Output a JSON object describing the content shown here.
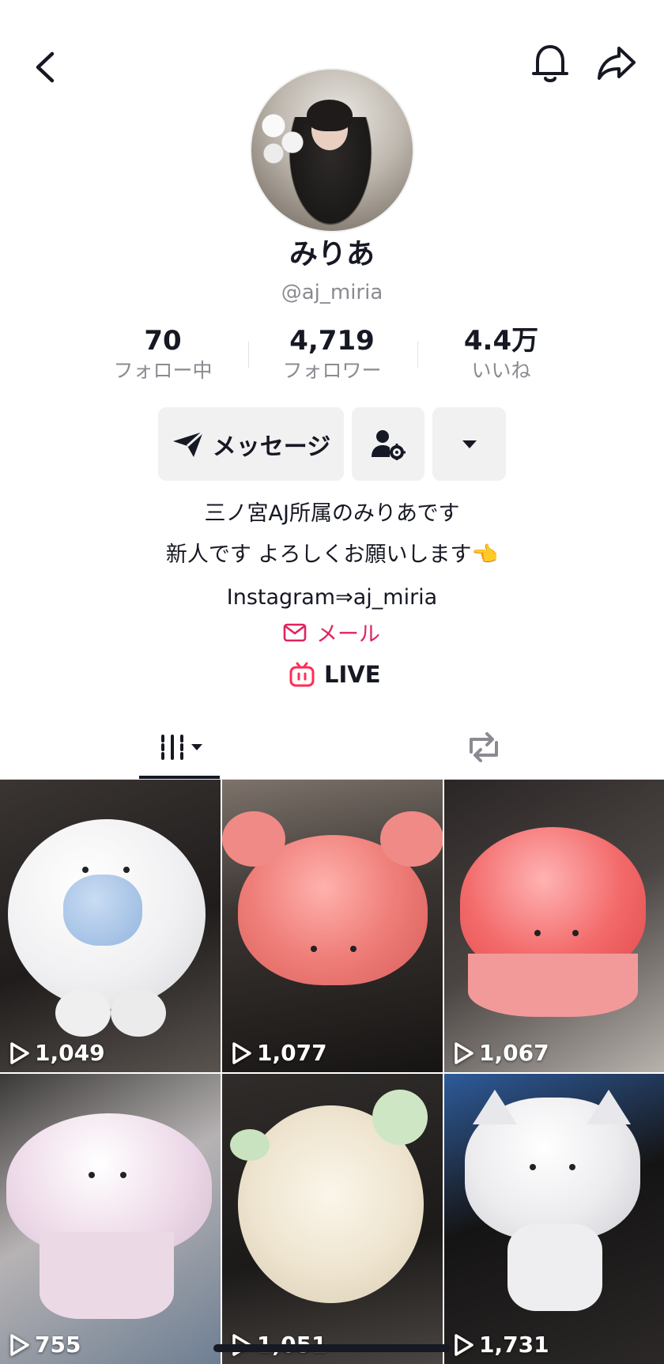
{
  "header": {
    "back_icon": "chevron-left-icon",
    "bell_icon": "bell-icon",
    "share_icon": "share-icon"
  },
  "profile": {
    "display_name": "みりあ",
    "username": "@aj_miria",
    "stats": [
      {
        "value": "70",
        "label": "フォロー中"
      },
      {
        "value": "4,719",
        "label": "フォロワー"
      },
      {
        "value": "4.4万",
        "label": "いいね"
      }
    ],
    "message_label": "メッセージ",
    "bio_lines": [
      "三ノ宮AJ所属のみりあです",
      "新人です よろしくお願いします👈",
      "Instagram⇒aj_miria"
    ],
    "email_label": "メール",
    "live_label": "LIVE"
  },
  "tabs": {
    "videos_icon": "grid-icon",
    "reposts_icon": "repost-icon"
  },
  "colors": {
    "accent_pink": "#e0245e",
    "live_pink": "#fe2c55",
    "text_primary": "#161823",
    "text_secondary": "#8a8b91",
    "button_bg": "#f1f1f2"
  },
  "videos": [
    {
      "views": "1,049"
    },
    {
      "views": "1,077"
    },
    {
      "views": "1,067"
    },
    {
      "views": "755"
    },
    {
      "views": "1,051"
    },
    {
      "views": "1,731"
    }
  ]
}
